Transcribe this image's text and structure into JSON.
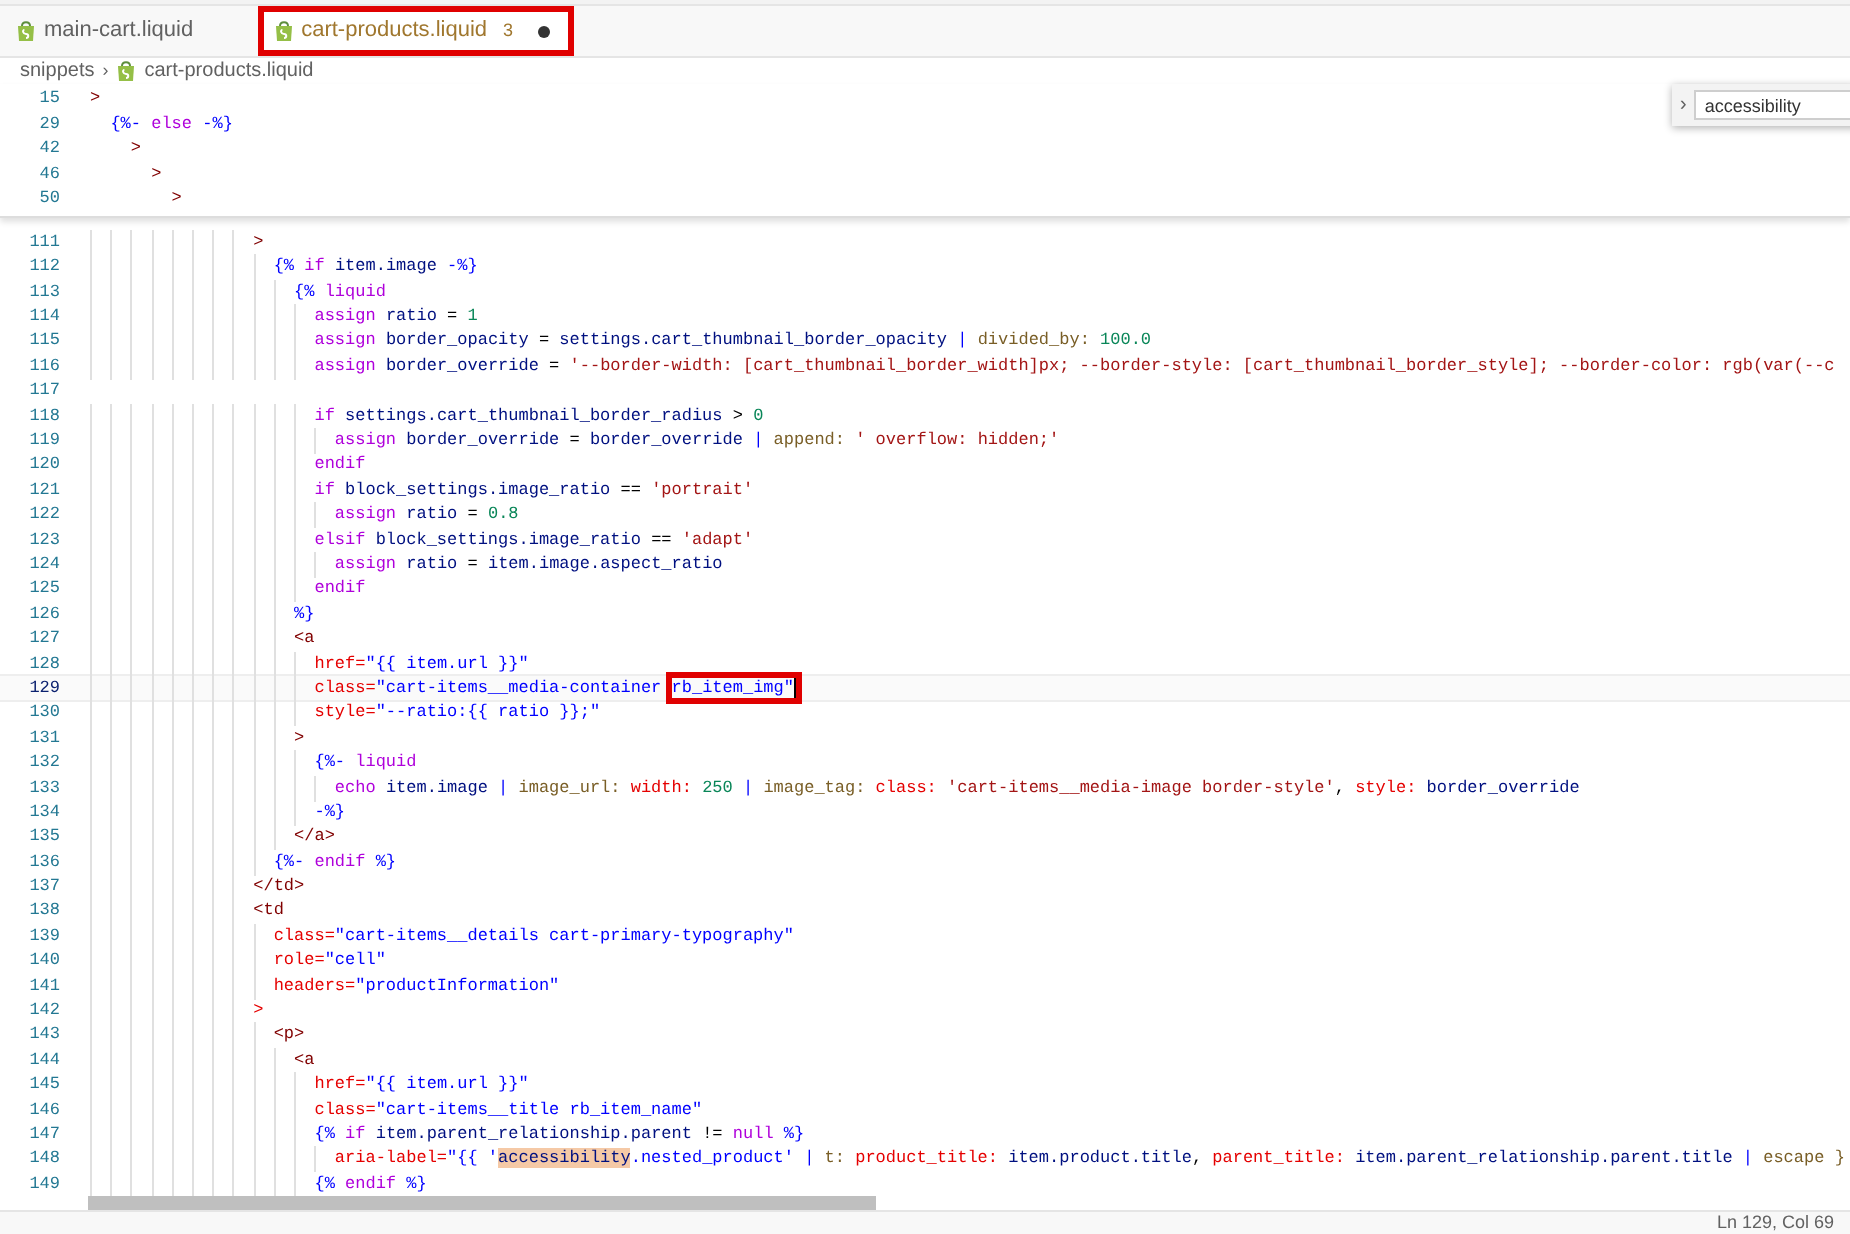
{
  "tabs": [
    {
      "label": "main-cart.liquid",
      "selected": false,
      "marked": false
    },
    {
      "label": "cart-products.liquid",
      "selected": true,
      "marked": true,
      "problems": "3",
      "dirty": true
    }
  ],
  "breadcrumb": {
    "separator": "›",
    "items": [
      {
        "label": "snippets",
        "kind": "folder"
      },
      {
        "label": "cart-products.liquid",
        "kind": "file"
      }
    ]
  },
  "find_widget": {
    "toggle": "›",
    "value": "accessibility"
  },
  "sticky_lines": [
    {
      "no": "15",
      "text": [
        {
          "t": ">",
          "kind": "tag"
        }
      ]
    },
    {
      "no": "29",
      "text": [
        {
          "t": "  {%- ",
          "kind": "delim"
        },
        {
          "t": "else ",
          "kind": "kw"
        },
        {
          "t": "-%}",
          "kind": "delim"
        }
      ]
    },
    {
      "no": "42",
      "text": [
        {
          "t": "    >",
          "kind": "tag"
        }
      ]
    },
    {
      "no": "46",
      "text": [
        {
          "t": "      >",
          "kind": "tag"
        }
      ]
    },
    {
      "no": "50",
      "text": [
        {
          "t": "        >",
          "kind": "tag"
        }
      ]
    }
  ],
  "lines": [
    {
      "no": "111",
      "current": false,
      "text": [
        {
          "t": "                >",
          "kind": "tag"
        }
      ]
    },
    {
      "no": "112",
      "current": false,
      "text": [
        {
          "t": "                  {% ",
          "kind": "delim"
        },
        {
          "t": "if ",
          "kind": "kw"
        },
        {
          "t": "item.image ",
          "kind": "var"
        },
        {
          "t": "-%}",
          "kind": "delim"
        }
      ]
    },
    {
      "no": "113",
      "current": false,
      "text": [
        {
          "t": "                    {% ",
          "kind": "delim"
        },
        {
          "t": "liquid",
          "kind": "kw"
        }
      ]
    },
    {
      "no": "114",
      "current": false,
      "text": [
        {
          "t": "                      assign ",
          "kind": "kw"
        },
        {
          "t": "ratio",
          "kind": "var"
        },
        {
          "t": " = ",
          "kind": "op"
        },
        {
          "t": "1",
          "kind": "num"
        }
      ]
    },
    {
      "no": "115",
      "current": false,
      "text": [
        {
          "t": "                      assign ",
          "kind": "kw"
        },
        {
          "t": "border_opacity",
          "kind": "var"
        },
        {
          "t": " = ",
          "kind": "op"
        },
        {
          "t": "settings.cart_thumbnail_border_opacity ",
          "kind": "var"
        },
        {
          "t": "| ",
          "kind": "pipe"
        },
        {
          "t": "divided_by: ",
          "kind": "filter"
        },
        {
          "t": "100.0",
          "kind": "num"
        }
      ]
    },
    {
      "no": "116",
      "current": false,
      "text": [
        {
          "t": "                      assign ",
          "kind": "kw"
        },
        {
          "t": "border_override",
          "kind": "var"
        },
        {
          "t": " = ",
          "kind": "op"
        },
        {
          "t": "'--border-width: [cart_thumbnail_border_width]px; --border-style: [cart_thumbnail_border_style]; --border-color: rgb(var(--c",
          "kind": "str"
        }
      ]
    },
    {
      "no": "117",
      "current": false
    },
    {
      "no": "118",
      "current": false,
      "text": [
        {
          "t": "                      if ",
          "kind": "kw"
        },
        {
          "t": "settings.cart_thumbnail_border_radius ",
          "kind": "var"
        },
        {
          "t": "> ",
          "kind": "op"
        },
        {
          "t": "0",
          "kind": "num"
        }
      ]
    },
    {
      "no": "119",
      "current": false,
      "text": [
        {
          "t": "                        assign ",
          "kind": "kw"
        },
        {
          "t": "border_override",
          "kind": "var"
        },
        {
          "t": " = ",
          "kind": "op"
        },
        {
          "t": "border_override ",
          "kind": "var"
        },
        {
          "t": "| ",
          "kind": "pipe"
        },
        {
          "t": "append: ",
          "kind": "filter"
        },
        {
          "t": "' overflow: hidden;'",
          "kind": "str"
        }
      ]
    },
    {
      "no": "120",
      "current": false,
      "text": [
        {
          "t": "                      endif",
          "kind": "kw"
        }
      ]
    },
    {
      "no": "121",
      "current": false,
      "text": [
        {
          "t": "                      if ",
          "kind": "kw"
        },
        {
          "t": "block_settings.image_ratio ",
          "kind": "var"
        },
        {
          "t": "== ",
          "kind": "op"
        },
        {
          "t": "'portrait'",
          "kind": "str"
        }
      ]
    },
    {
      "no": "122",
      "current": false,
      "text": [
        {
          "t": "                        assign ",
          "kind": "kw"
        },
        {
          "t": "ratio",
          "kind": "var"
        },
        {
          "t": " = ",
          "kind": "op"
        },
        {
          "t": "0.8",
          "kind": "num"
        }
      ]
    },
    {
      "no": "123",
      "current": false,
      "text": [
        {
          "t": "                      elsif ",
          "kind": "kw"
        },
        {
          "t": "block_settings.image_ratio ",
          "kind": "var"
        },
        {
          "t": "== ",
          "kind": "op"
        },
        {
          "t": "'adapt'",
          "kind": "str"
        }
      ]
    },
    {
      "no": "124",
      "current": false,
      "text": [
        {
          "t": "                        assign ",
          "kind": "kw"
        },
        {
          "t": "ratio",
          "kind": "var"
        },
        {
          "t": " = ",
          "kind": "op"
        },
        {
          "t": "item.image.aspect_ratio",
          "kind": "var"
        }
      ]
    },
    {
      "no": "125",
      "current": false,
      "text": [
        {
          "t": "                      endif",
          "kind": "kw"
        }
      ]
    },
    {
      "no": "126",
      "current": false,
      "text": [
        {
          "t": "                    %}",
          "kind": "delim"
        }
      ]
    },
    {
      "no": "127",
      "current": false,
      "text": [
        {
          "t": "                    <a",
          "kind": "tag"
        }
      ]
    },
    {
      "no": "128",
      "current": false,
      "text": [
        {
          "t": "                      href=",
          "kind": "attr"
        },
        {
          "t": "\"{{ item.url }}\"",
          "kind": "aval"
        }
      ]
    },
    {
      "no": "129",
      "current": true,
      "text": [
        {
          "t": "                      class=",
          "kind": "attr"
        },
        {
          "t": "\"cart-items__media-container ",
          "kind": "aval"
        },
        {
          "t": "rb_item_img\"",
          "kind": "marked"
        }
      ]
    },
    {
      "no": "130",
      "current": false,
      "text": [
        {
          "t": "                      style=",
          "kind": "attr"
        },
        {
          "t": "\"--ratio:{{ ratio }};\"",
          "kind": "aval"
        }
      ]
    },
    {
      "no": "131",
      "current": false,
      "text": [
        {
          "t": "                    >",
          "kind": "tag"
        }
      ]
    },
    {
      "no": "132",
      "current": false,
      "text": [
        {
          "t": "                      {%- ",
          "kind": "delim"
        },
        {
          "t": "liquid",
          "kind": "kw"
        }
      ]
    },
    {
      "no": "133",
      "current": false,
      "text": [
        {
          "t": "                        echo ",
          "kind": "kw"
        },
        {
          "t": "item.image ",
          "kind": "var"
        },
        {
          "t": "| ",
          "kind": "pipe"
        },
        {
          "t": "image_url: ",
          "kind": "filter"
        },
        {
          "t": "width: ",
          "kind": "param"
        },
        {
          "t": "250 ",
          "kind": "num"
        },
        {
          "t": "| ",
          "kind": "pipe"
        },
        {
          "t": "image_tag: ",
          "kind": "filter"
        },
        {
          "t": "class: ",
          "kind": "param"
        },
        {
          "t": "'cart-items__media-image border-style'",
          "kind": "str"
        },
        {
          "t": ", ",
          "kind": "op"
        },
        {
          "t": "style: ",
          "kind": "param"
        },
        {
          "t": "border_override",
          "kind": "var"
        }
      ]
    },
    {
      "no": "134",
      "current": false,
      "text": [
        {
          "t": "                      -%}",
          "kind": "delim"
        }
      ]
    },
    {
      "no": "135",
      "current": false,
      "text": [
        {
          "t": "                    </a>",
          "kind": "tag"
        }
      ]
    },
    {
      "no": "136",
      "current": false,
      "text": [
        {
          "t": "                  {%- ",
          "kind": "delim"
        },
        {
          "t": "endif ",
          "kind": "kw"
        },
        {
          "t": "%}",
          "kind": "delim"
        }
      ]
    },
    {
      "no": "137",
      "current": false,
      "text": [
        {
          "t": "                </td>",
          "kind": "tag"
        }
      ]
    },
    {
      "no": "138",
      "current": false,
      "text": [
        {
          "t": "                <td",
          "kind": "tag"
        }
      ]
    },
    {
      "no": "139",
      "current": false,
      "text": [
        {
          "t": "                  class=",
          "kind": "attr"
        },
        {
          "t": "\"cart-items__details cart-primary-typography\"",
          "kind": "aval"
        }
      ]
    },
    {
      "no": "140",
      "current": false,
      "text": [
        {
          "t": "                  role=",
          "kind": "attr"
        },
        {
          "t": "\"cell\"",
          "kind": "aval"
        }
      ]
    },
    {
      "no": "141",
      "current": false,
      "text": [
        {
          "t": "                  headers=",
          "kind": "attr"
        },
        {
          "t": "\"productInformation\"",
          "kind": "aval"
        }
      ]
    },
    {
      "no": "142",
      "current": false,
      "text": [
        {
          "t": "                >",
          "kind": "attr"
        }
      ]
    },
    {
      "no": "143",
      "current": false,
      "text": [
        {
          "t": "                  <p>",
          "kind": "tag"
        }
      ]
    },
    {
      "no": "144",
      "current": false,
      "text": [
        {
          "t": "                    <a",
          "kind": "tag"
        }
      ]
    },
    {
      "no": "145",
      "current": false,
      "text": [
        {
          "t": "                      href=",
          "kind": "attr"
        },
        {
          "t": "\"{{ item.url }}\"",
          "kind": "aval"
        }
      ]
    },
    {
      "no": "146",
      "current": false,
      "text": [
        {
          "t": "                      class=",
          "kind": "attr"
        },
        {
          "t": "\"cart-items__title rb_item_name\"",
          "kind": "aval"
        }
      ]
    },
    {
      "no": "147",
      "current": false,
      "text": [
        {
          "t": "                      {% ",
          "kind": "delim"
        },
        {
          "t": "if ",
          "kind": "kw"
        },
        {
          "t": "item.parent_relationship.parent ",
          "kind": "var"
        },
        {
          "t": "!= ",
          "kind": "op"
        },
        {
          "t": "null ",
          "kind": "kw"
        },
        {
          "t": "%}",
          "kind": "delim"
        }
      ]
    },
    {
      "no": "148",
      "current": false,
      "text": [
        {
          "t": "                        aria-label=",
          "kind": "attr"
        },
        {
          "t": "\"{{ '",
          "kind": "aval"
        },
        {
          "t": "accessibility",
          "kind": "match"
        },
        {
          "t": ".nested_product' ",
          "kind": "aval"
        },
        {
          "t": "| ",
          "kind": "pipe"
        },
        {
          "t": "t: ",
          "kind": "filter"
        },
        {
          "t": "product_title: ",
          "kind": "param"
        },
        {
          "t": "item.product.title",
          "kind": "var"
        },
        {
          "t": ", ",
          "kind": "op"
        },
        {
          "t": "parent_title: ",
          "kind": "param"
        },
        {
          "t": "item.parent_relationship.parent.title ",
          "kind": "var"
        },
        {
          "t": "| ",
          "kind": "pipe"
        },
        {
          "t": "escape }",
          "kind": "filter"
        }
      ]
    },
    {
      "no": "149",
      "current": false,
      "text": [
        {
          "t": "                      {% ",
          "kind": "delim"
        },
        {
          "t": "endif ",
          "kind": "kw"
        },
        {
          "t": "%}",
          "kind": "delim"
        }
      ]
    }
  ],
  "status_bar": {
    "position": "Ln 129, Col 69"
  }
}
